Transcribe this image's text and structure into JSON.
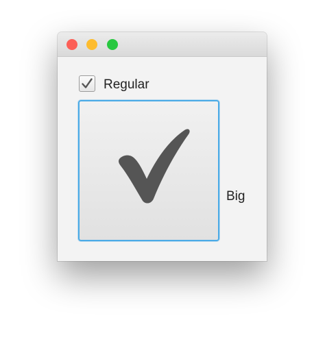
{
  "window": {
    "controls": {
      "close_color": "#fc5f57",
      "minimize_color": "#fdbc2e",
      "zoom_color": "#28c840"
    }
  },
  "checkboxes": [
    {
      "label": "Regular",
      "checked": true,
      "size": "regular",
      "focused": false,
      "check_icon": "checkmark-icon"
    },
    {
      "label": "Big",
      "checked": true,
      "size": "big",
      "focused": true,
      "check_icon": "checkmark-icon"
    }
  ],
  "colors": {
    "focus_ring": "#4aaae6",
    "check_mark": "#555555"
  }
}
